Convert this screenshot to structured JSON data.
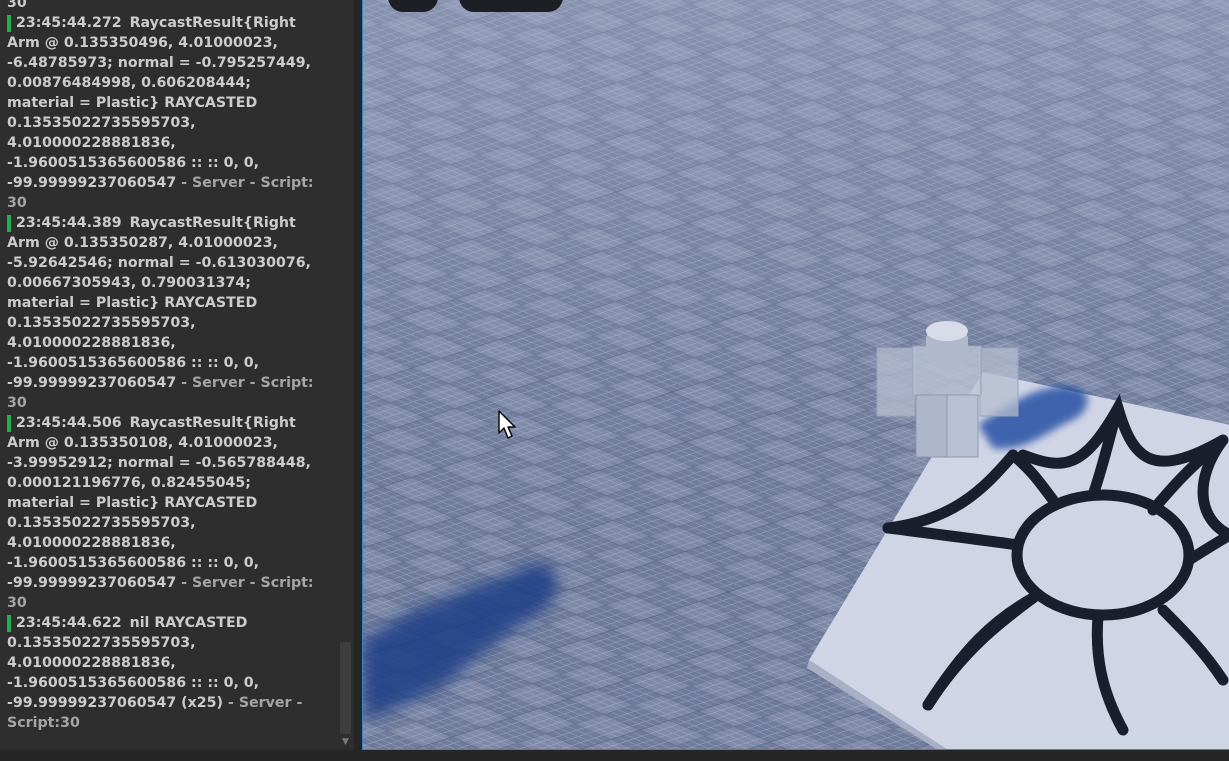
{
  "output": {
    "header_tail": "30",
    "messages": [
      {
        "timestamp": "23:45:44.272",
        "lines": [
          "RaycastResult{Right",
          "Arm @ 0.135350496, 4.01000023,",
          "-6.48785973; normal = -0.795257449,",
          "0.00876484998, 0.606208444;",
          "material = Plastic} RAYCASTED",
          "0.13535022735595703,",
          "4.010000228881836,",
          "-1.9600515365600586 :: :: 0, 0,"
        ],
        "last_text": "-99.99999237060547",
        "source": "Server - Script:",
        "source_line": "30"
      },
      {
        "timestamp": "23:45:44.389",
        "lines": [
          "RaycastResult{Right",
          "Arm @ 0.135350287, 4.01000023,",
          "-5.92642546; normal = -0.613030076,",
          "0.00667305943, 0.790031374;",
          "material = Plastic} RAYCASTED",
          "0.13535022735595703,",
          "4.010000228881836,",
          "-1.9600515365600586 :: :: 0, 0,"
        ],
        "last_text": "-99.99999237060547",
        "source": "Server - Script:",
        "source_line": "30"
      },
      {
        "timestamp": "23:45:44.506",
        "lines": [
          "RaycastResult{Right",
          "Arm @ 0.135350108, 4.01000023,",
          "-3.99952912; normal = -0.565788448,",
          "0.000121196776, 0.82455045;",
          "material = Plastic} RAYCASTED",
          "0.13535022735595703,",
          "4.010000228881836,",
          "-1.9600515365600586 :: :: 0, 0,"
        ],
        "last_text": "-99.99999237060547",
        "source": "Server - Script:",
        "source_line": "30"
      },
      {
        "timestamp": "23:45:44.622",
        "lines": [
          "nil RAYCASTED",
          "0.13535022735595703,",
          "4.010000228881836,",
          "-1.9600515365600586 :: :: 0, 0,"
        ],
        "last_text": "-99.99999237060547 (x25)",
        "source": "Server -",
        "source_line": "Script:30"
      }
    ]
  },
  "colors": {
    "panel_bg": "#2e2e2e",
    "message_text": "#cccccc",
    "message_bar": "#22b24c",
    "viewport_baseplate": "#7380a0",
    "viewport_border": "#3b83c4"
  },
  "icons": {
    "scroll_down": "chevron-down-icon",
    "cursor": "mouse-cursor-icon"
  },
  "viewport": {
    "scene": "3d-baseplate-with-character",
    "decal": "black-sun-decal-on-white-part"
  }
}
